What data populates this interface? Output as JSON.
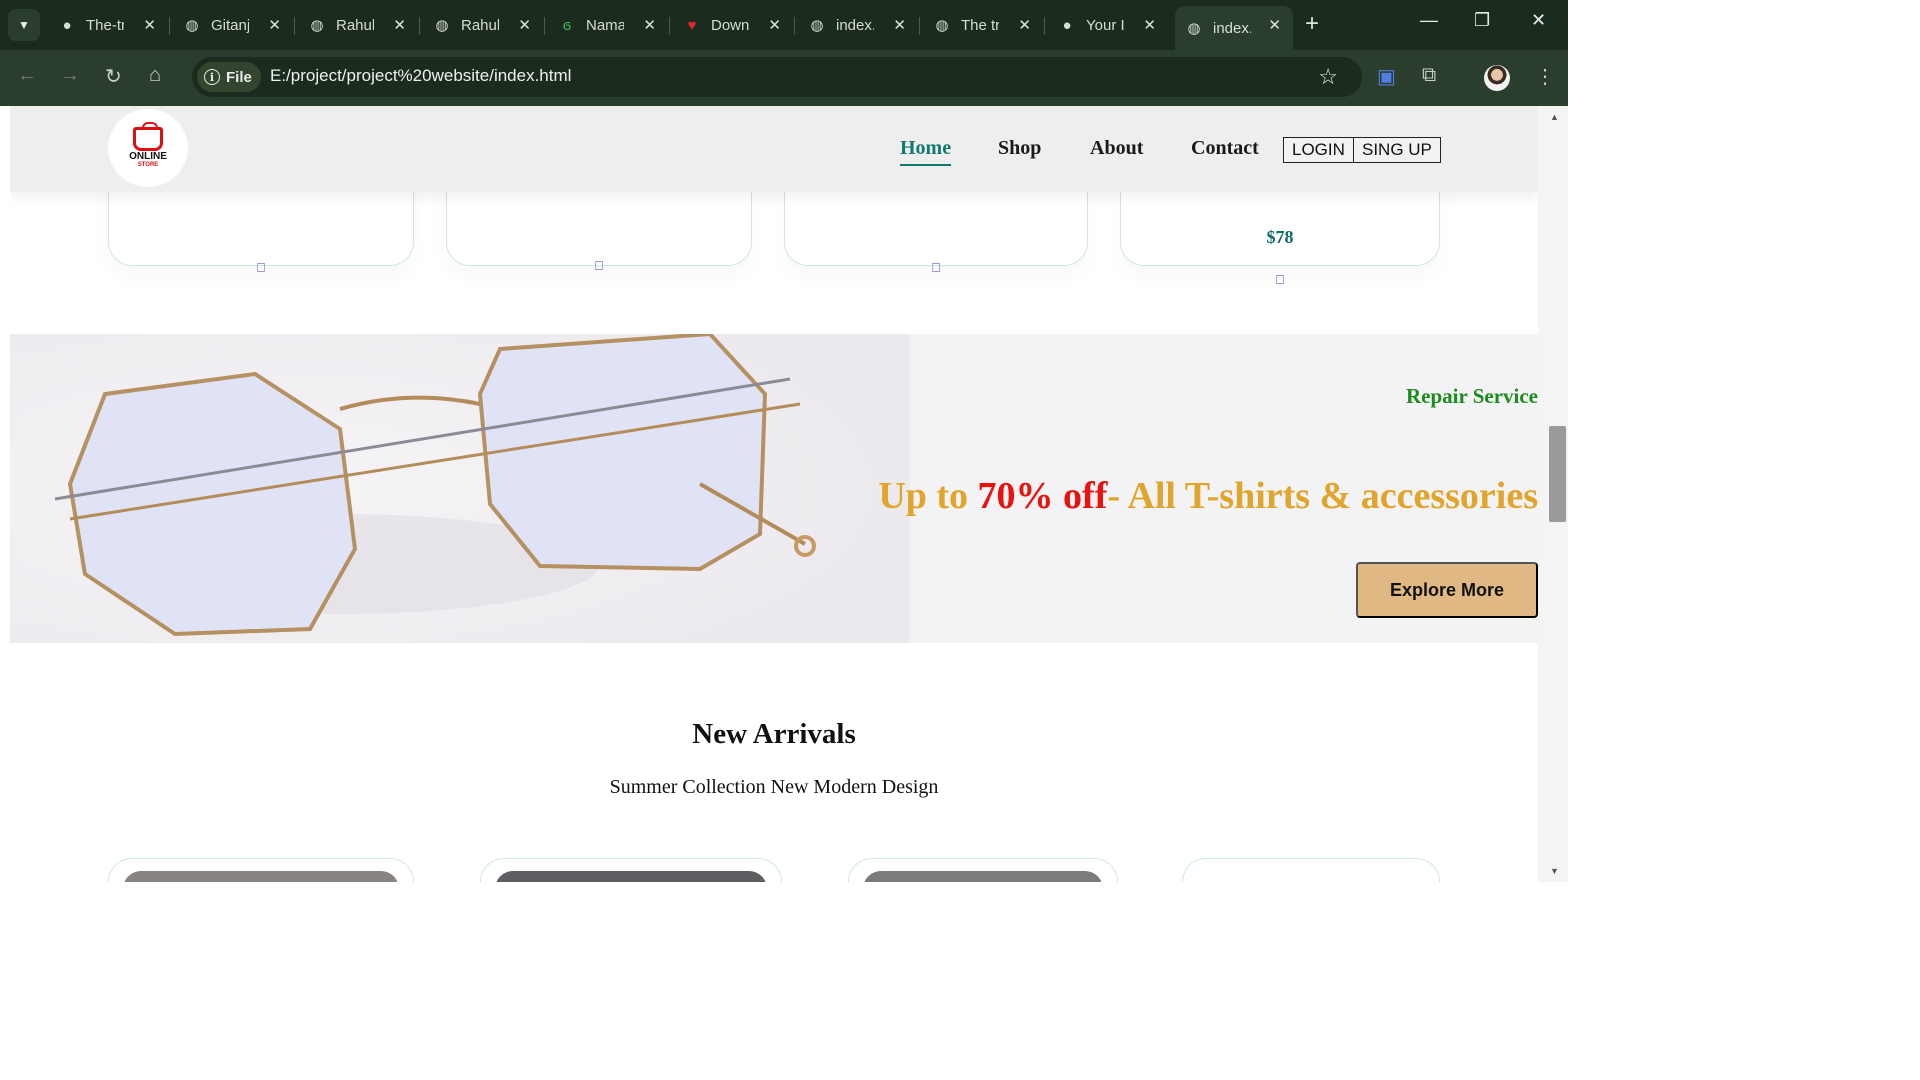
{
  "browser": {
    "tabs": [
      {
        "title": "The-tr",
        "icon": "github-icon",
        "active": false
      },
      {
        "title": "Gitanj",
        "icon": "globe-icon",
        "active": false
      },
      {
        "title": "Rahul",
        "icon": "globe-icon",
        "active": false
      },
      {
        "title": "Rahul",
        "icon": "globe-icon",
        "active": false
      },
      {
        "title": "Nama",
        "icon": "leaf-icon",
        "active": false
      },
      {
        "title": "Down",
        "icon": "heart-icon",
        "active": false
      },
      {
        "title": "index.",
        "icon": "globe-icon",
        "active": false
      },
      {
        "title": "The tr",
        "icon": "globe-icon",
        "active": false
      },
      {
        "title": "Your I",
        "icon": "github-icon",
        "active": false
      },
      {
        "title": "index.",
        "icon": "globe-icon",
        "active": true
      }
    ],
    "address": {
      "chip_label": "File",
      "url": "E:/project/project%20website/index.html"
    }
  },
  "site": {
    "logo": {
      "line1": "ONLINE",
      "line2": "STORE"
    },
    "nav": [
      {
        "label": "Home",
        "active": true
      },
      {
        "label": "Shop",
        "active": false
      },
      {
        "label": "About",
        "active": false
      },
      {
        "label": "Contact",
        "active": false
      }
    ],
    "login_label": "LOGIN",
    "signup_label": "SING UP",
    "cards": [
      {
        "price": "",
        "cart_icon": "cart-icon"
      },
      {
        "price": "",
        "cart_icon": "cart-icon"
      },
      {
        "price": "",
        "cart_icon": "cart-icon"
      },
      {
        "price": "$78",
        "cart_icon": "cart-icon"
      }
    ],
    "banner": {
      "kicker": "Repair Service",
      "headline_prefix": "Up to ",
      "headline_highlight": "70% off",
      "headline_suffix": "- All T-shirts & accessories",
      "button_label": "Explore More"
    },
    "arrivals": {
      "title": "New Arrivals",
      "subtitle": "Summer Collection New Modern Design"
    }
  },
  "colors": {
    "accent": "#117a6e",
    "promo_gold": "#e0a52a",
    "promo_red": "#e8130f",
    "button_tan": "#e0b883",
    "repair_green": "#1a8c1a"
  }
}
